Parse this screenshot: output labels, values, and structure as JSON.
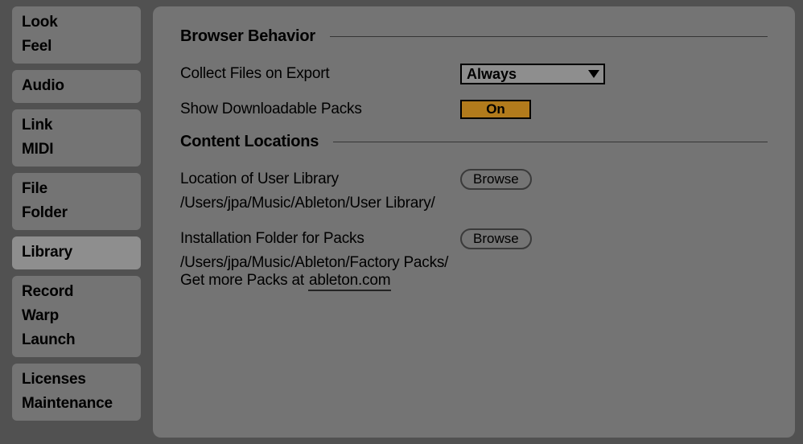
{
  "sidebar": {
    "groups": [
      {
        "tabs": [
          "Look",
          "Feel"
        ],
        "selected": false
      },
      {
        "tabs": [
          "Audio"
        ],
        "selected": false
      },
      {
        "tabs": [
          "Link",
          "MIDI"
        ],
        "selected": false
      },
      {
        "tabs": [
          "File",
          "Folder"
        ],
        "selected": false
      },
      {
        "tabs": [
          "Library"
        ],
        "selected": true
      },
      {
        "tabs": [
          "Record",
          "Warp",
          "Launch"
        ],
        "selected": false
      },
      {
        "tabs": [
          "Licenses",
          "Maintenance"
        ],
        "selected": false
      }
    ]
  },
  "sections": {
    "browser_behavior": {
      "title": "Browser Behavior",
      "collect_files": {
        "label": "Collect Files on Export",
        "value": "Always"
      },
      "show_packs": {
        "label": "Show Downloadable Packs",
        "value": "On"
      }
    },
    "content_locations": {
      "title": "Content Locations",
      "user_library": {
        "label": "Location of User Library",
        "browse": "Browse",
        "path": "/Users/jpa/Music/Ableton/User Library/"
      },
      "install_folder": {
        "label": "Installation Folder for Packs",
        "browse": "Browse",
        "path": "/Users/jpa/Music/Ableton/Factory Packs/"
      },
      "more_packs_prefix": "Get more Packs at ",
      "more_packs_link": "ableton.com"
    }
  }
}
